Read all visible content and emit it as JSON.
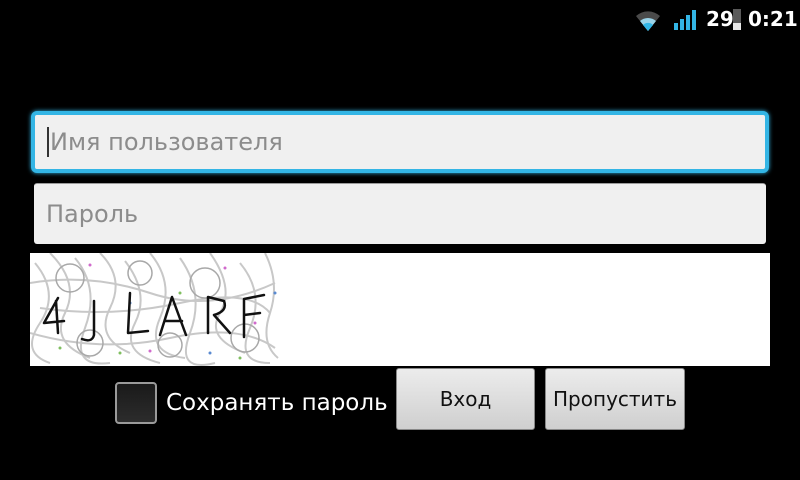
{
  "status_bar": {
    "battery_percent": "29",
    "time": "0:21",
    "wifi_icon": "wifi-icon",
    "signal_icon": "cell-signal-icon",
    "battery_icon": "battery-icon",
    "accent_color": "#33b5e5"
  },
  "login_form": {
    "username": {
      "value": "",
      "placeholder": "Имя пользователя"
    },
    "password": {
      "value": "",
      "placeholder": "Пароль"
    },
    "captcha": {
      "text": "4JLARF"
    },
    "remember_password": {
      "label": "Сохранять пароль",
      "checked": false
    },
    "login_button": "Вход",
    "skip_button": "Пропустить"
  }
}
